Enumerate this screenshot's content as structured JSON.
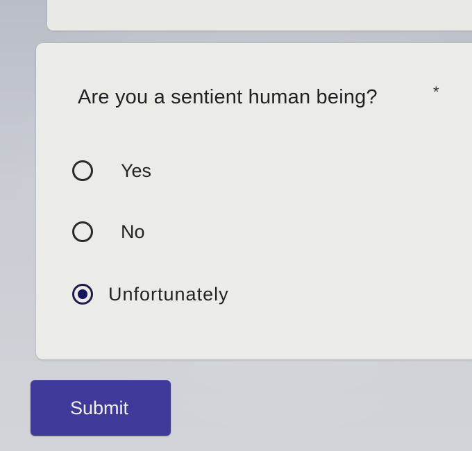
{
  "form": {
    "question": {
      "text": "Are you a sentient human being?",
      "required_marker": "*"
    },
    "options": [
      {
        "label": "Yes",
        "selected": false
      },
      {
        "label": "No",
        "selected": false
      },
      {
        "label": "Unfortunately",
        "selected": true
      }
    ],
    "submit_label": "Submit"
  },
  "colors": {
    "accent": "#3f3a9a",
    "radio_selected": "#16145a",
    "card": "#ebebe7"
  },
  "icons": {
    "radio_unselected": "radio-unchecked-icon",
    "radio_selected": "radio-checked-icon"
  }
}
